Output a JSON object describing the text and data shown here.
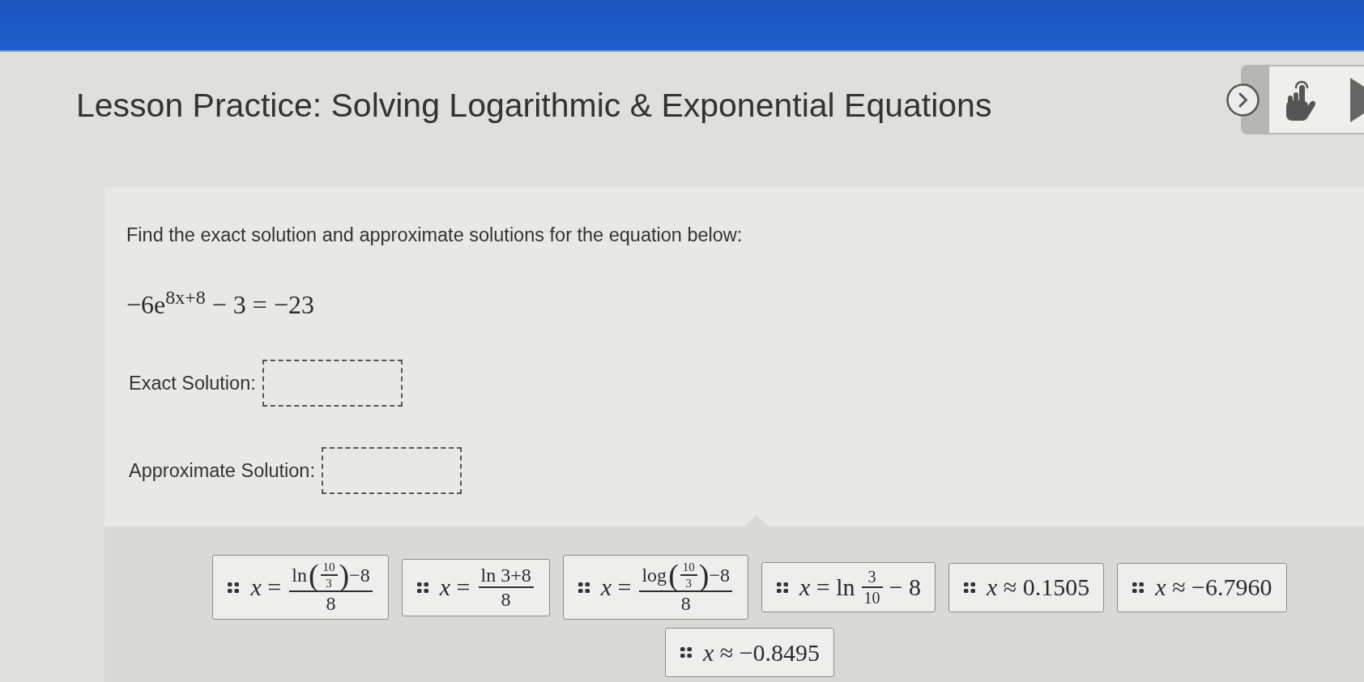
{
  "header": {
    "title": "Lesson Practice: Solving Logarithmic & Exponential Equations"
  },
  "question": {
    "prompt": "Find the exact solution and approximate solutions for the equation below:",
    "equation": "−6e$^{8x+8}$ − 3 = −23",
    "fields": [
      {
        "label": "Exact Solution:"
      },
      {
        "label": "Approximate Solution:"
      }
    ]
  },
  "answer_tiles": [
    {
      "kind": "fraction",
      "lhs": "*x* =",
      "numerator": {
        "kind": "function",
        "name": "ln",
        "open": "(",
        "argument": {
          "numerator": "10",
          "denominator": "3"
        },
        "close": ")",
        "tail": "−8"
      },
      "denominator": "8"
    },
    {
      "kind": "fraction",
      "lhs": "*x* =",
      "numerator": {
        "kind": "text",
        "text": "ln 3+8"
      },
      "denominator": "8"
    },
    {
      "kind": "fraction",
      "lhs": "*x* =",
      "numerator": {
        "kind": "function",
        "name": "log",
        "open": "(",
        "argument": {
          "numerator": "10",
          "denominator": "3"
        },
        "close": ")",
        "tail": "−8"
      },
      "denominator": "8"
    },
    {
      "kind": "inline_fraction",
      "lhs": "*x* = ln",
      "fraction": {
        "numerator": "3",
        "denominator": "10"
      },
      "tail": "− 8"
    },
    {
      "kind": "plain",
      "text": "*x* ≈ 0.1505"
    },
    {
      "kind": "plain",
      "text": "*x* ≈ −6.7960"
    },
    {
      "kind": "plain",
      "text": "*x* ≈ −0.8495"
    }
  ]
}
